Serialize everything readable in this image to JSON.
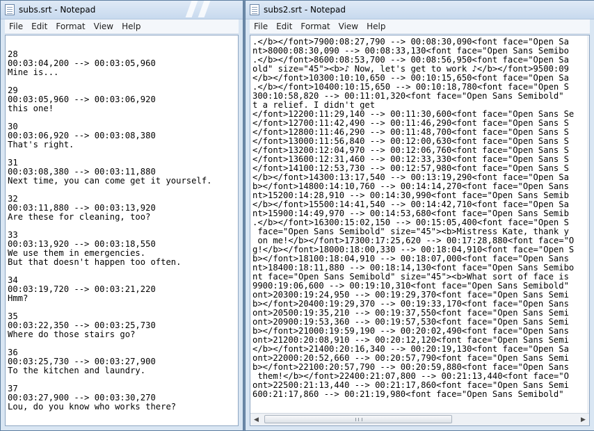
{
  "window1": {
    "title": "subs.srt - Notepad",
    "menu": [
      "File",
      "Edit",
      "Format",
      "View",
      "Help"
    ],
    "lines": [
      "",
      "28",
      "00:03:04,200 --> 00:03:05,960",
      "Mine is...",
      "",
      "29",
      "00:03:05,960 --> 00:03:06,920",
      "this one!",
      "",
      "30",
      "00:03:06,920 --> 00:03:08,380",
      "That's right.",
      "",
      "31",
      "00:03:08,380 --> 00:03:11,880",
      "Next time, you can come get it yourself.",
      "",
      "32",
      "00:03:11,880 --> 00:03:13,920",
      "Are these for cleaning, too?",
      "",
      "33",
      "00:03:13,920 --> 00:03:18,550",
      "We use them in emergencies.",
      "But that doesn't happen too often.",
      "",
      "34",
      "00:03:19,720 --> 00:03:21,220",
      "Hmm?",
      "",
      "35",
      "00:03:22,350 --> 00:03:25,730",
      "Where do those stairs go?",
      "",
      "36",
      "00:03:25,730 --> 00:03:27,900",
      "To the kitchen and laundry.",
      "",
      "37",
      "00:03:27,900 --> 00:03:30,270",
      "Lou, do you know who works there?"
    ]
  },
  "window2": {
    "title": "subs2.srt - Notepad",
    "menu": [
      "File",
      "Edit",
      "Format",
      "View",
      "Help"
    ],
    "lines": [
      ".</b></font>7900:08:27,790 --> 00:08:30,090<font face=\"Open Sa",
      "nt>8000:08:30,090 --> 00:08:33,130<font face=\"Open Sans Semibo",
      ".</b></font>8600:08:53,700 --> 00:08:56,950<font face=\"Open Sa",
      "old\" size=\"45\"><b>♪ Now, let's get to work ♪</b></font>9500:09",
      "</b></font>10300:10:10,650 --> 00:10:15,650<font face=\"Open Sa",
      ".</b></font>10400:10:15,650 --> 00:10:18,780<font face=\"Open S",
      "300:10:58,820 --> 00:11:01,320<font face=\"Open Sans Semibold\"",
      "t a relief. I didn't get",
      "</font>12200:11:29,140 --> 00:11:30,600<font face=\"Open Sans Se",
      "</font>12700:11:42,490 --> 00:11:46,290<font face=\"Open Sans S",
      "</font>12800:11:46,290 --> 00:11:48,700<font face=\"Open Sans S",
      "</font>13000:11:56,840 --> 00:12:00,630<font face=\"Open Sans S",
      "</font>13200:12:04,970 --> 00:12:06,760<font face=\"Open Sans S",
      "</font>13600:12:31,460 --> 00:12:33,330<font face=\"Open Sans S",
      "</font>14100:12:53,730 --> 00:12:57,980<font face=\"Open Sans S",
      "</b></font>14300:13:17,540 --> 00:13:19,290<font face=\"Open Sa",
      "b></font>14800:14:10,760 --> 00:14:14,270<font face=\"Open Sans",
      "nt>15200:14:28,910 --> 00:14:30,990<font face=\"Open Sans Semib",
      "</b></font>15500:14:41,540 --> 00:14:42,710<font face=\"Open Sa",
      "nt>15900:14:49,970 --> 00:14:53,680<font face=\"Open Sans Semib",
      ".</b></font>16300:15:02,150 --> 00:15:05,400<font face=\"Open S",
      " face=\"Open Sans Semibold\" size=\"45\"><b>Mistress Kate, thank y",
      " on me!</b></font>17300:17:25,620 --> 00:17:28,880<font face=\"O",
      "g!</b></font>18000:18:00,330 --> 00:18:04,910<font face=\"Open S",
      "b></font>18100:18:04,910 --> 00:18:07,000<font face=\"Open Sans",
      "nt>18400:18:11,880 --> 00:18:14,130<font face=\"Open Sans Semibo",
      "nt face=\"Open Sans Semibold\" size=\"45\"><b>What sort of face is",
      "9900:19:06,600 --> 00:19:10,310<font face=\"Open Sans Semibold\"",
      "ont>20300:19:24,950 --> 00:19:29,370<font face=\"Open Sans Semi",
      "b></font>20400:19:29,370 --> 00:19:33,170<font face=\"Open Sans",
      "ont>20500:19:35,210 --> 00:19:37,550<font face=\"Open Sans Semi",
      "ont>20900:19:53,360 --> 00:19:57,530<font face=\"Open Sans Semi",
      "b></font>21000:19:59,190 --> 00:20:02,490<font face=\"Open Sans",
      "ont>21200:20:08,910 --> 00:20:12,120<font face=\"Open Sans Semi",
      "</b></font>21400:20:16,340 --> 00:20:19,130<font face=\"Open Sa",
      "ont>22000:20:52,660 --> 00:20:57,790<font face=\"Open Sans Semi",
      "b></font>22100:20:57,790 --> 00:20:59,880<font face=\"Open Sans",
      " them!</b></font>22400:21:07,800 --> 00:21:13,440<font face=\"O",
      "ont>22500:21:13,440 --> 00:21:17,860<font face=\"Open Sans Semi",
      "600:21:17,860 --> 00:21:19,980<font face=\"Open Sans Semibold\""
    ]
  },
  "icons": {
    "scroll_left": "◀",
    "scroll_right": "▶"
  }
}
